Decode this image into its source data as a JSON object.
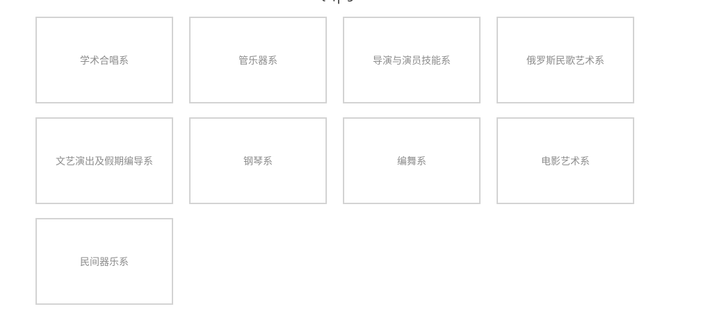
{
  "departments": [
    {
      "label": "学术合唱系"
    },
    {
      "label": "管乐器系"
    },
    {
      "label": "导演与演员技能系"
    },
    {
      "label": "俄罗斯民歌艺术系"
    },
    {
      "label": "文艺演出及假期编导系"
    },
    {
      "label": "钢琴系"
    },
    {
      "label": "编舞系"
    },
    {
      "label": "电影艺术系"
    },
    {
      "label": "民间器乐系"
    }
  ]
}
